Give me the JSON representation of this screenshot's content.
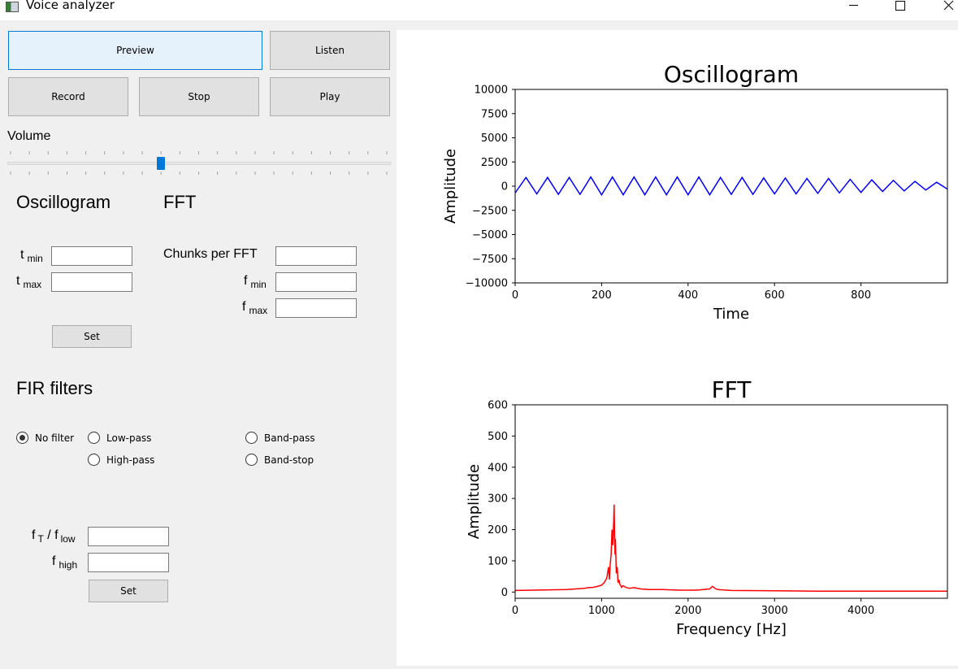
{
  "window": {
    "title": "Voice analyzer",
    "controls": [
      "minimize-icon",
      "maximize-icon",
      "close-icon"
    ]
  },
  "buttons": {
    "preview": "Preview",
    "listen": "Listen",
    "record": "Record",
    "stop": "Stop",
    "play": "Play"
  },
  "volume": {
    "label": "Volume",
    "value_fraction": 0.4,
    "accent": "#0078d7"
  },
  "oscillogram_settings": {
    "heading": "Oscillogram",
    "tmin_main": "t",
    "tmin_sub": "min",
    "tmax_main": "t",
    "tmax_sub": "max",
    "tmin_value": "",
    "tmax_value": "",
    "set_label": "Set"
  },
  "fft_settings": {
    "heading": "FFT",
    "chunks_label": "Chunks per FFT",
    "fmin_main": "f",
    "fmin_sub": "min",
    "fmax_main": "f",
    "fmax_sub": "max",
    "chunks_value": "",
    "fmin_value": "",
    "fmax_value": ""
  },
  "fir": {
    "heading": "FIR filters",
    "options": [
      {
        "label": "No filter",
        "selected": true
      },
      {
        "label": "Low-pass",
        "selected": false
      },
      {
        "label": "High-pass",
        "selected": false
      },
      {
        "label": "Band-pass",
        "selected": false
      },
      {
        "label": "Band-stop",
        "selected": false
      }
    ],
    "ft_main": "f",
    "ft_sub": "T",
    "sep": " / ",
    "flow_main": "f",
    "flow_sub": "low",
    "fhigh_main": "f",
    "fhigh_sub": "high",
    "ft_value": "",
    "fhigh_value": "",
    "set_label": "Set"
  },
  "chart_data": [
    {
      "type": "line",
      "title": "Oscillogram",
      "xlabel": "Time",
      "ylabel": "Amplitude",
      "xlim": [
        0,
        1000
      ],
      "ylim": [
        -10000,
        10000
      ],
      "xticks": [
        0,
        200,
        400,
        600,
        800
      ],
      "xtick_labels": [
        "0",
        "200",
        "400",
        "600",
        "800"
      ],
      "yticks": [
        10000,
        7500,
        5000,
        2500,
        0,
        -2500,
        -5000,
        -7500,
        -10000
      ],
      "ytick_labels": [
        "10000",
        "7500",
        "5000",
        "2500",
        "0",
        "−2500",
        "−5000",
        "−7500",
        "−10000"
      ],
      "color": "#0000ff",
      "grid": false,
      "series": [
        {
          "x": [
            0,
            25,
            50,
            75,
            100,
            125,
            150,
            175,
            200,
            225,
            250,
            275,
            300,
            325,
            350,
            375,
            400,
            425,
            450,
            475,
            500,
            525,
            550,
            575,
            600,
            625,
            650,
            675,
            700,
            725,
            750,
            775,
            800,
            825,
            850,
            875,
            900,
            925,
            950,
            975,
            1000
          ],
          "y": [
            -700,
            900,
            -800,
            900,
            -850,
            900,
            -850,
            950,
            -900,
            950,
            -900,
            950,
            -900,
            950,
            -900,
            950,
            -900,
            950,
            -900,
            900,
            -850,
            900,
            -850,
            850,
            -800,
            850,
            -800,
            800,
            -750,
            800,
            -700,
            700,
            -650,
            650,
            -550,
            600,
            -500,
            500,
            -400,
            400,
            -300
          ]
        }
      ]
    },
    {
      "type": "line",
      "title": "FFT",
      "xlabel": "Frequency [Hz]",
      "ylabel": "Amplitude",
      "xlim": [
        0,
        5000
      ],
      "ylim": [
        -20,
        600
      ],
      "xticks": [
        0,
        1000,
        2000,
        3000,
        4000
      ],
      "xtick_labels": [
        "0",
        "1000",
        "2000",
        "3000",
        "4000"
      ],
      "yticks": [
        600,
        500,
        400,
        300,
        200,
        100,
        0
      ],
      "ytick_labels": [
        "600",
        "500",
        "400",
        "300",
        "200",
        "100",
        "0"
      ],
      "color": "#ff0000",
      "grid": false,
      "series": [
        {
          "x": [
            0,
            200,
            400,
            600,
            700,
            800,
            850,
            900,
            950,
            1000,
            1030,
            1060,
            1080,
            1090,
            1100,
            1110,
            1120,
            1130,
            1140,
            1145,
            1150,
            1155,
            1160,
            1170,
            1180,
            1190,
            1200,
            1210,
            1220,
            1230,
            1250,
            1280,
            1320,
            1380,
            1450,
            1550,
            1700,
            1900,
            2100,
            2250,
            2280,
            2300,
            2320,
            2350,
            2500,
            3000,
            3500,
            4000,
            4500,
            5000
          ],
          "y": [
            5,
            6,
            7,
            8,
            10,
            12,
            14,
            15,
            18,
            22,
            30,
            45,
            80,
            40,
            90,
            120,
            200,
            150,
            230,
            280,
            180,
            120,
            170,
            60,
            80,
            30,
            40,
            25,
            22,
            15,
            20,
            15,
            12,
            14,
            10,
            8,
            8,
            6,
            6,
            10,
            18,
            15,
            10,
            8,
            5,
            4,
            3,
            3,
            3,
            3
          ]
        }
      ]
    }
  ]
}
